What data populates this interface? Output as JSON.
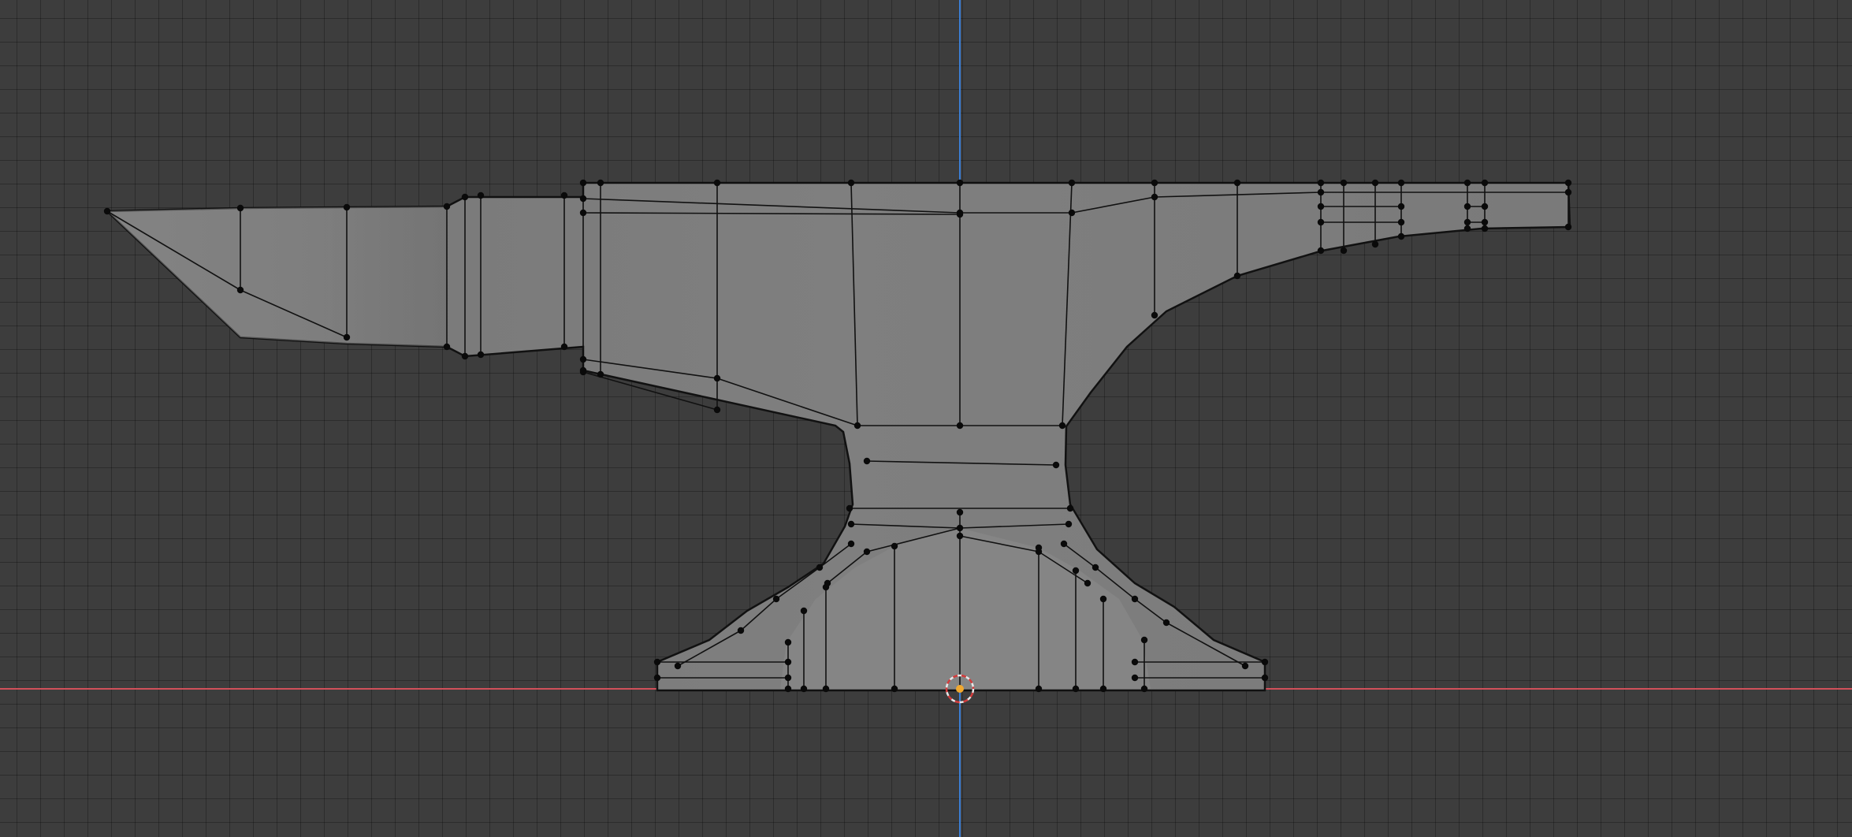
{
  "viewport": {
    "background": "#3d3d3d",
    "grid_color": "#2f2f2f"
  },
  "axes": {
    "x_axis_color": "#d0505a",
    "z_axis_color": "#3b7fd6"
  },
  "mesh": {
    "name": "anvil",
    "face_color": "#7e7e7e",
    "edge_color": "#111111",
    "vertex_color": "#0a0a0a"
  },
  "origin": {
    "icon": "3d-cursor-icon",
    "ring_color_a": "#e8e8e8",
    "ring_color_b": "#d23c3c",
    "dot_color": "#f0a830"
  }
}
